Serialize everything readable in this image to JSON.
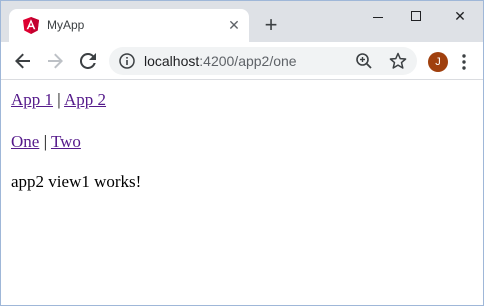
{
  "tab": {
    "title": "MyApp",
    "close_glyph": "✕",
    "new_tab_glyph": "+"
  },
  "window_controls": {
    "close_glyph": "✕"
  },
  "omnibox": {
    "host": "localhost",
    "path": ":4200/app2/one"
  },
  "profile": {
    "initial": "J",
    "color": "#a0400e"
  },
  "app_nav": {
    "link1": "App 1",
    "separator": "|",
    "link2": "App 2"
  },
  "view_nav": {
    "link1": "One",
    "separator": "|",
    "link2": "Two"
  },
  "content": {
    "text": "app2 view1 works!"
  },
  "colors": {
    "link_visited": "#551a8b",
    "tabstrip_bg": "#dee1e6",
    "omnibox_bg": "#f1f3f4",
    "angular_red": "#dd0031"
  },
  "icons": {
    "favicon": "angular-logo-icon",
    "back": "arrow-left-icon",
    "forward": "arrow-right-icon",
    "reload": "reload-icon",
    "site_info": "info-icon",
    "zoom": "zoom-icon",
    "bookmark": "star-icon",
    "menu": "kebab-menu-icon"
  }
}
